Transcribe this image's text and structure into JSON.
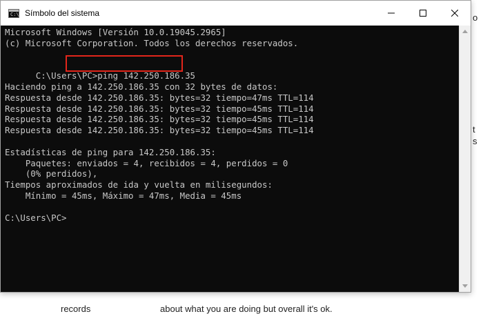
{
  "window": {
    "title": "Símbolo del sistema",
    "icon_text": "C:\\"
  },
  "terminal": {
    "lines": [
      "Microsoft Windows [Versión 10.0.19045.2965]",
      "(c) Microsoft Corporation. Todos los derechos reservados.",
      "",
      "C:\\Users\\PC>ping 142.250.186.35",
      "",
      "Haciendo ping a 142.250.186.35 con 32 bytes de datos:",
      "Respuesta desde 142.250.186.35: bytes=32 tiempo=47ms TTL=114",
      "Respuesta desde 142.250.186.35: bytes=32 tiempo=45ms TTL=114",
      "Respuesta desde 142.250.186.35: bytes=32 tiempo=45ms TTL=114",
      "Respuesta desde 142.250.186.35: bytes=32 tiempo=45ms TTL=114",
      "",
      "Estadísticas de ping para 142.250.186.35:",
      "    Paquetes: enviados = 4, recibidos = 4, perdidos = 0",
      "    (0% perdidos),",
      "Tiempos aproximados de ida y vuelta en milisegundos:",
      "    Mínimo = 45ms, Máximo = 47ms, Media = 45ms",
      "",
      "C:\\Users\\PC>"
    ]
  },
  "background": {
    "bottom_left": "records",
    "bottom_middle": "about what you are doing but overall it's ok.",
    "right_fragments": [
      "o",
      "t",
      "s"
    ]
  },
  "colors": {
    "terminal_bg": "#0c0c0c",
    "terminal_fg": "#c8c8c8",
    "highlight": "#e3261b"
  }
}
